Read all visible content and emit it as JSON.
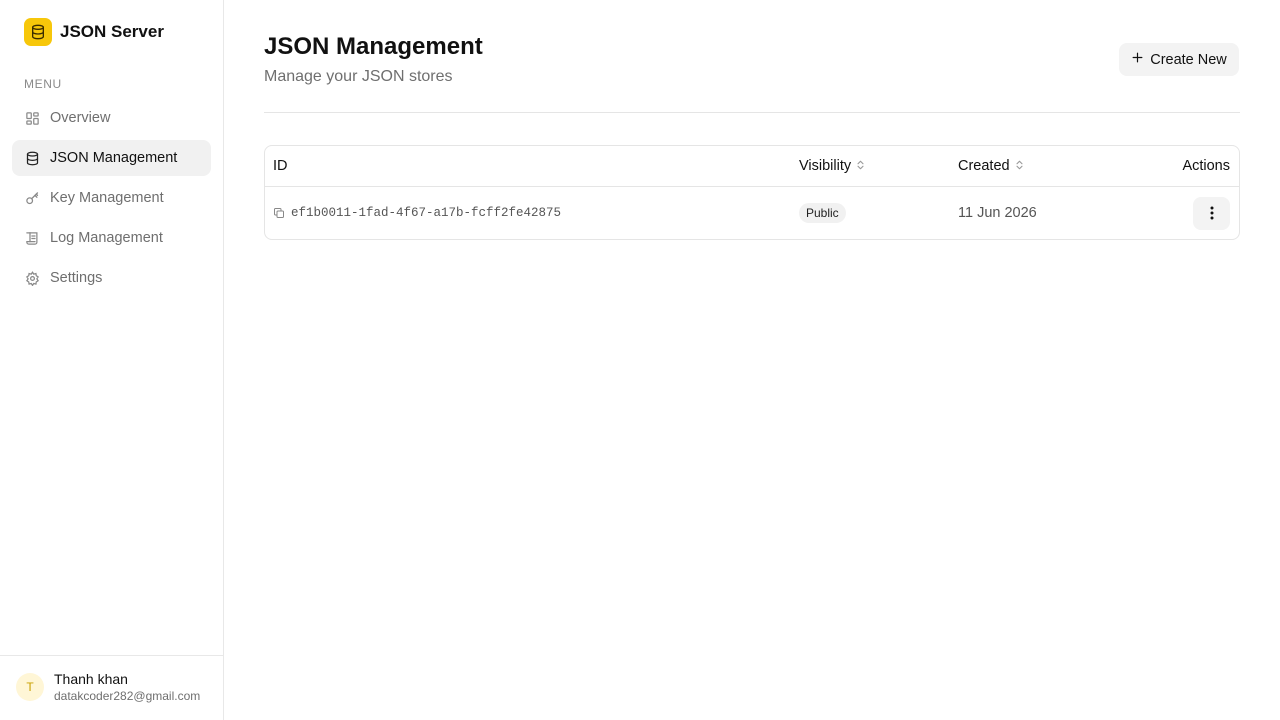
{
  "app": {
    "name": "JSON Server",
    "logo_icon": "database-icon",
    "accent": "#f7c70a"
  },
  "sidebar": {
    "menu_label": "MENU",
    "items": [
      {
        "label": "Overview",
        "icon": "grid-icon",
        "active": false
      },
      {
        "label": "JSON Management",
        "icon": "database-icon",
        "active": true
      },
      {
        "label": "Key Management",
        "icon": "key-icon",
        "active": false
      },
      {
        "label": "Log Management",
        "icon": "log-icon",
        "active": false
      },
      {
        "label": "Settings",
        "icon": "gear-icon",
        "active": false
      }
    ],
    "user": {
      "initial": "T",
      "name": "Thanh khan",
      "email": "datakcoder282@gmail.com"
    }
  },
  "main": {
    "title": "JSON Management",
    "subtitle": "Manage your JSON stores",
    "create_button": "Create New",
    "table": {
      "columns": {
        "id": "ID",
        "visibility": "Visibility",
        "created": "Created",
        "actions": "Actions"
      },
      "rows": [
        {
          "id": "ef1b0011-1fad-4f67-a17b-fcff2fe42875",
          "visibility": "Public",
          "created": "11 Jun 2026"
        }
      ]
    }
  }
}
